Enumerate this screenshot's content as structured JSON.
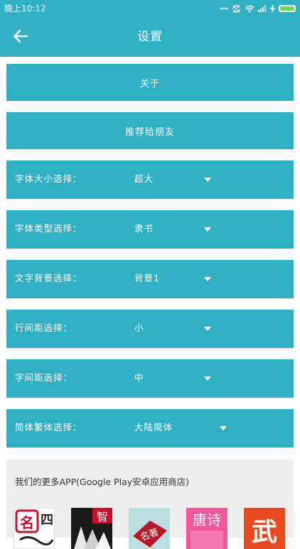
{
  "status_bar": {
    "time": "晚上10:12",
    "icons": [
      "more-dots-icon",
      "sync-icon",
      "wifi-icon",
      "signal-icon",
      "charging-icon",
      "battery-icon"
    ]
  },
  "app_bar": {
    "title": "设置",
    "back_icon": "back-arrow-icon"
  },
  "buttons": {
    "about": "关于",
    "recommend": "推荐给朋友"
  },
  "settings": [
    {
      "label": "字体大小选择：",
      "value": "超大"
    },
    {
      "label": "字体类型选择：",
      "value": "隶书"
    },
    {
      "label": "文字背景选择：",
      "value": "背景1"
    },
    {
      "label": "行间距选择：",
      "value": "小"
    },
    {
      "label": "字间距选择：",
      "value": "中"
    },
    {
      "label": "简体繁体选择：",
      "value": "大陆简体"
    }
  ],
  "more_apps": {
    "title": "我们的更多APP(Google Play安卓应用商店)",
    "apps": [
      {
        "name": "mingyan-app-icon",
        "glyphs": "名四"
      },
      {
        "name": "zhi-app-icon",
        "glyphs": "智"
      },
      {
        "name": "mingzhu-app-icon",
        "glyphs": "名著"
      },
      {
        "name": "tangshi-app-icon",
        "glyphs": "唐诗"
      },
      {
        "name": "wu-app-icon",
        "glyphs": "武"
      }
    ]
  },
  "colors": {
    "primary": "#2fb0c4",
    "panel_bg": "#eeeeee",
    "battery_fill": "#6fdc4e"
  }
}
